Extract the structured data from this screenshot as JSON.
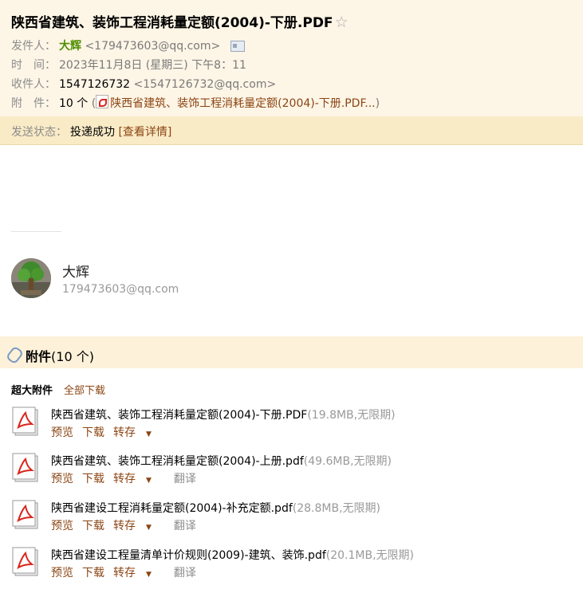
{
  "subject": "陕西省建筑、装饰工程消耗量定额(2004)-下册.PDF",
  "star_icon": "star-outline-icon",
  "sender": {
    "label": "发件人：",
    "name": "大辉",
    "email": "<179473603@qq.com>"
  },
  "time": {
    "label": "时　间：",
    "value": "2023年11月8日 (星期三) 下午8：11"
  },
  "recipient": {
    "label": "收件人：",
    "name": "1547126732",
    "email": "<1547126732@qq.com>"
  },
  "attach_row": {
    "label": "附　件：",
    "count": "10 个",
    "open": "(",
    "link": "陕西省建筑、装饰工程消耗量定额(2004)-下册.PDF...",
    "close": ")"
  },
  "status": {
    "label": "发送状态：",
    "value": "投递成功",
    "details": "[查看详情]"
  },
  "signature": {
    "name": "大辉",
    "email": "179473603@qq.com"
  },
  "attachments": {
    "title": "附件",
    "count": "(10 个)",
    "group_label": "超大附件",
    "download_all": "全部下载",
    "files": [
      {
        "name": "陕西省建筑、装饰工程消耗量定额(2004)-下册.PDF",
        "meta": "(19.8MB,无限期)",
        "preview": "预览",
        "download": "下载",
        "save": "转存",
        "translate": ""
      },
      {
        "name": "陕西省建筑、装饰工程消耗量定额(2004)-上册.pdf",
        "meta": "(49.6MB,无限期)",
        "preview": "预览",
        "download": "下载",
        "save": "转存",
        "translate": "翻译"
      },
      {
        "name": "陕西省建设工程消耗量定额(2004)-补充定额.pdf",
        "meta": "(28.8MB,无限期)",
        "preview": "预览",
        "download": "下载",
        "save": "转存",
        "translate": "翻译"
      },
      {
        "name": "陕西省建设工程量清单计价规则(2009)-建筑、装饰.pdf",
        "meta": "(20.1MB,无限期)",
        "preview": "预览",
        "download": "下载",
        "save": "转存",
        "translate": "翻译"
      }
    ]
  },
  "colors": {
    "header_bg": "#fdf5e6",
    "status_bg": "#faebc7",
    "sender_name": "#4f8f00",
    "link": "#8b4513",
    "muted": "#999999"
  }
}
